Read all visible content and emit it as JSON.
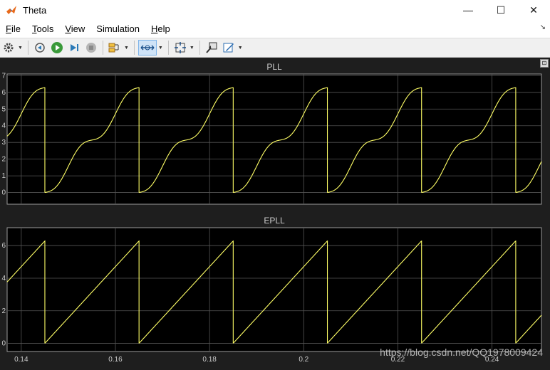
{
  "window": {
    "title": "Theta",
    "minimize_glyph": "—",
    "maximize_glyph": "☐",
    "close_glyph": "✕"
  },
  "menu": {
    "items": [
      {
        "first": "F",
        "rest": "ile"
      },
      {
        "first": "T",
        "rest": "ools"
      },
      {
        "first": "V",
        "rest": "iew"
      },
      {
        "first": "",
        "rest": "Simulation",
        "ul_index": 1
      },
      {
        "first": "H",
        "rest": "elp"
      }
    ],
    "corner_glyph": "↘"
  },
  "toolbar": {
    "icons": [
      "gear-icon",
      "step-back-icon",
      "run-icon",
      "step-forward-icon",
      "stop-icon",
      "signal-selector-icon",
      "zoom-time-icon",
      "fit-to-view-icon",
      "highlight-simulink-block-icon",
      "style-icon"
    ]
  },
  "colors": {
    "signal": "#ffff66",
    "plot_bg": "#000000",
    "grid": "#555555",
    "axes_text": "#cccccc",
    "accent": "#0072bd"
  },
  "watermark": "https://blog.csdn.net/QQ1978009424",
  "chart_data": [
    {
      "type": "line",
      "title": "PLL",
      "xlim": [
        0.137,
        0.2505
      ],
      "ylim": [
        -0.7,
        7.1
      ],
      "yticks": [
        0,
        1,
        2,
        3,
        4,
        5,
        6,
        7
      ],
      "ytick_labels": [
        "0",
        "1",
        "2",
        "3",
        "4",
        "5",
        "6",
        "7"
      ],
      "xticks": [
        0.14,
        0.16,
        0.18,
        0.2,
        0.22,
        0.24
      ],
      "grid": true,
      "series": [
        {
          "shape": "s-shaped sawtooth",
          "period": 0.02,
          "wrap_times": [
            0.145,
            0.165,
            0.185,
            0.205,
            0.225,
            0.245
          ],
          "min": 0,
          "max": 6.28,
          "mid_plateau": 3.14
        }
      ]
    },
    {
      "type": "line",
      "title": "EPLL",
      "xlim": [
        0.137,
        0.2505
      ],
      "ylim": [
        -0.5,
        7.1
      ],
      "yticks": [
        0,
        2,
        4,
        6
      ],
      "ytick_labels": [
        "0",
        "2",
        "4",
        "6"
      ],
      "xticks": [
        0.14,
        0.16,
        0.18,
        0.2,
        0.22,
        0.24
      ],
      "xtick_labels": [
        "0.14",
        "0.16",
        "0.18",
        "0.2",
        "0.22",
        "0.24"
      ],
      "grid": true,
      "series": [
        {
          "shape": "linear sawtooth",
          "period": 0.02,
          "wrap_times": [
            0.145,
            0.165,
            0.185,
            0.205,
            0.225,
            0.245
          ],
          "min": 0,
          "max": 6.28
        }
      ]
    }
  ]
}
